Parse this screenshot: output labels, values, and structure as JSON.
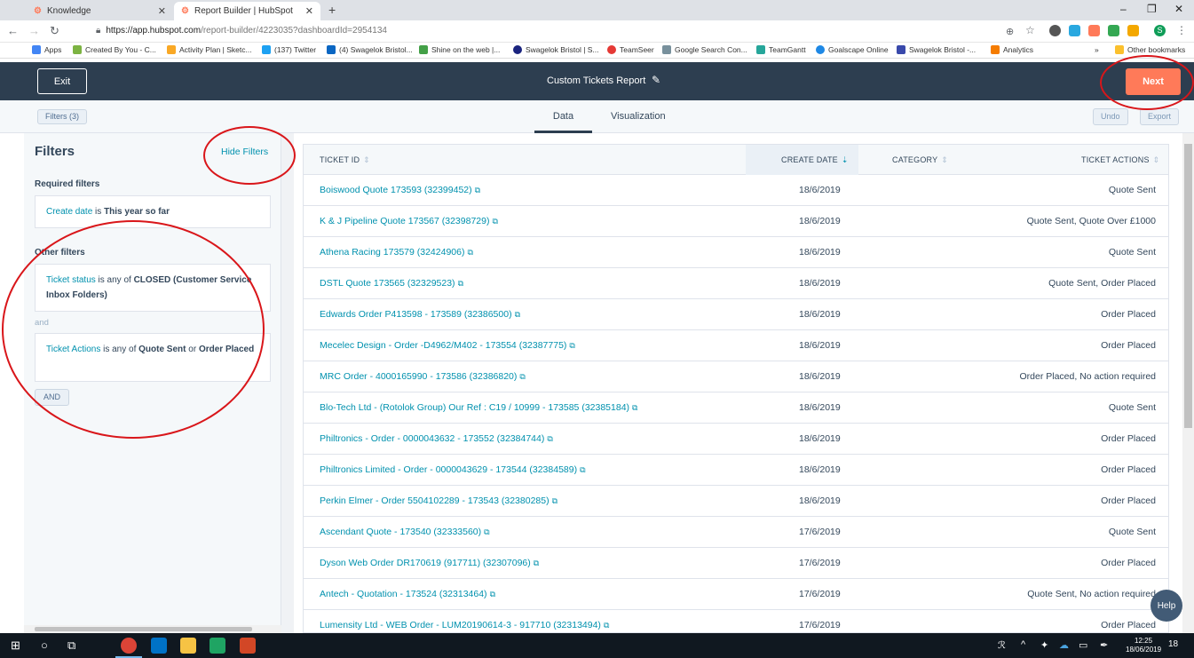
{
  "browser": {
    "tabs": [
      {
        "title": "Knowledge"
      },
      {
        "title": "Report Builder | HubSpot"
      }
    ],
    "url_host": "https://app.hubspot.com",
    "url_path": "/report-builder/4223035?dashboardId=2954134",
    "bookmarks": [
      "Apps",
      "Created By You - C...",
      "Activity Plan | Sketc...",
      "(137) Twitter",
      "(4) Swagelok Bristol...",
      "Shine on the web |...",
      "Swagelok Bristol | S...",
      "TeamSeer",
      "Google Search Con...",
      "TeamGantt",
      "Goalscape Online",
      "Swagelok Bristol -...",
      "Analytics",
      "Other bookmarks"
    ]
  },
  "header": {
    "exit_label": "Exit",
    "report_title": "Custom Tickets Report",
    "next_label": "Next"
  },
  "subbar": {
    "filters_button": "Filters (3)",
    "tab_data": "Data",
    "tab_visualization": "Visualization",
    "undo": "Undo",
    "export": "Export"
  },
  "filters": {
    "title": "Filters",
    "hide_link": "Hide Filters",
    "required_label": "Required filters",
    "required": {
      "field": "Create date",
      "op": "is",
      "value": "This year so far"
    },
    "other_label": "Other filters",
    "filter1": {
      "field": "Ticket status",
      "op": "is any of",
      "value": "CLOSED (Customer Service Inbox Folders)"
    },
    "and_text": "and",
    "filter2": {
      "field": "Ticket Actions",
      "op": "is any of",
      "value1": "Quote Sent",
      "or": "or",
      "value2": "Order Placed"
    },
    "and_button": "AND"
  },
  "table": {
    "columns": [
      "TICKET ID",
      "CREATE DATE",
      "CATEGORY",
      "TICKET ACTIONS"
    ],
    "rows": [
      {
        "id": "Boiswood Quote 173593 (32399452)",
        "date": "18/6/2019",
        "actions": "Quote Sent"
      },
      {
        "id": "K & J Pipeline Quote 173567 (32398729)",
        "date": "18/6/2019",
        "actions": "Quote Sent, Quote Over £1000"
      },
      {
        "id": "Athena Racing 173579 (32424906)",
        "date": "18/6/2019",
        "actions": "Quote Sent"
      },
      {
        "id": "DSTL Quote 173565 (32329523)",
        "date": "18/6/2019",
        "actions": "Quote Sent, Order Placed"
      },
      {
        "id": "Edwards Order P413598 - 173589 (32386500)",
        "date": "18/6/2019",
        "actions": "Order Placed"
      },
      {
        "id": "Mecelec Design - Order -D4962/M402 - 173554 (32387775)",
        "date": "18/6/2019",
        "actions": "Order Placed"
      },
      {
        "id": "MRC Order - 4000165990 - 173586 (32386820)",
        "date": "18/6/2019",
        "actions": "Order Placed, No action required"
      },
      {
        "id": "Blo-Tech Ltd - (Rotolok Group) Our Ref : C19 / 10999 - 173585 (32385184)",
        "date": "18/6/2019",
        "actions": "Quote Sent"
      },
      {
        "id": "Philtronics - Order - 0000043632 - 173552 (32384744)",
        "date": "18/6/2019",
        "actions": "Order Placed"
      },
      {
        "id": "Philtronics Limited - Order - 0000043629 - 173544 (32384589)",
        "date": "18/6/2019",
        "actions": "Order Placed"
      },
      {
        "id": "Perkin Elmer - Order 5504102289 - 173543 (32380285)",
        "date": "18/6/2019",
        "actions": "Order Placed"
      },
      {
        "id": "Ascendant Quote - 173540 (32333560)",
        "date": "17/6/2019",
        "actions": "Quote Sent"
      },
      {
        "id": "Dyson Web Order DR170619 (917711) (32307096)",
        "date": "17/6/2019",
        "actions": "Order Placed"
      },
      {
        "id": "Antech - Quotation - 173524 (32313464)",
        "date": "17/6/2019",
        "actions": "Quote Sent, No action required"
      },
      {
        "id": "Lumensity Ltd - WEB Order - LUM20190614-3 - 917710 (32313494)",
        "date": "17/6/2019",
        "actions": "Order Placed"
      }
    ]
  },
  "help_label": "Help",
  "taskbar": {
    "time": "12:25",
    "date": "18/06/2019",
    "notif": "18"
  },
  "colors": {
    "header": "#2d3e50",
    "accent": "#ff7a59",
    "link": "#0091ae",
    "annotation": "#d9161a"
  }
}
